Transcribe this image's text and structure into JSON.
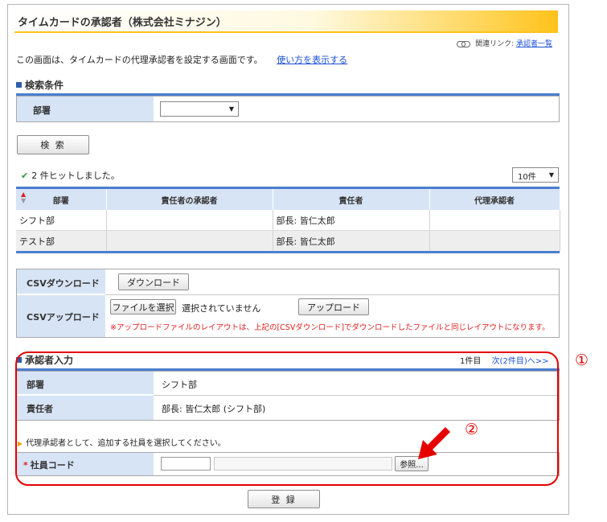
{
  "page": {
    "title": "タイムカードの承認者（株式会社ミナジン）"
  },
  "related": {
    "label": "関連リンク:",
    "link": "承認者一覧"
  },
  "description": {
    "text": "この画面は、タイムカードの代理承認者を設定する画面です。",
    "help_link": "使い方を表示する"
  },
  "search": {
    "section_title": "検索条件",
    "dept_label": "部署",
    "dept_value": "",
    "search_button": "検 索"
  },
  "results": {
    "hit_text": "2 件ヒットしました。",
    "per_page": "10件",
    "columns": [
      "部署",
      "責任者の承認者",
      "責任者",
      "代理承認者"
    ],
    "rows": [
      [
        "シフト部",
        "",
        "部長: 皆仁太郎",
        ""
      ],
      [
        "テスト部",
        "",
        "部長: 皆仁太郎",
        ""
      ]
    ]
  },
  "csv": {
    "download_label": "CSVダウンロード",
    "download_button": "ダウンロード",
    "upload_label": "CSVアップロード",
    "file_button": "ファイルを選択",
    "file_status": "選択されていません",
    "upload_button": "アップロード",
    "note": "※アップロードファイルのレイアウトは、上記の[CSVダウンロード]でダウンロードしたファイルと同じレイアウトになります。"
  },
  "approver": {
    "section_title": "承認者入力",
    "count": "1件目",
    "next_link": "次(2件目)へ>>",
    "dept_label": "部署",
    "dept_value": "シフト部",
    "manager_label": "責任者",
    "manager_value": "部長: 皆仁太郎 (シフト部)",
    "instruction": "代理承認者として、追加する社員を選択してください。",
    "required_mark": "*",
    "code_label": "社員コード",
    "ref_button": "参照...",
    "register_button": "登 録"
  },
  "annotations": {
    "one": "①",
    "two": "②"
  },
  "colors": {
    "accent": "#4a7fcf",
    "header_bg": "#d7e4f6",
    "highlight": "#e60000",
    "title_gradient": "#ffc21a"
  }
}
